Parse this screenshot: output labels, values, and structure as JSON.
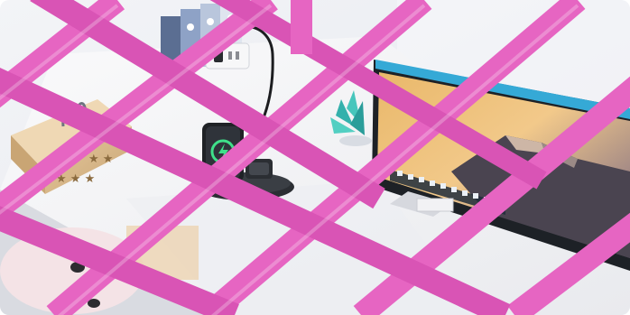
{
  "image": {
    "kind": "product-photo",
    "subject": "pink-metal-loft-bed-with-desk-setup",
    "colors": {
      "bed_frame": "#e665c2",
      "bed_frame_shadow": "#c946a6",
      "desk_top": "#f4f4f6",
      "wall": "#eef0f4",
      "monitor_bezel": "#1d2126",
      "monitor_accent": "#35a9d6",
      "charger_body": "#2b2e33",
      "charger_ring": "#3fe08a",
      "wood_organizer": "#d9b98a",
      "plant": "#3fb8b2"
    },
    "icons": [
      "wireless-charger-icon"
    ]
  }
}
